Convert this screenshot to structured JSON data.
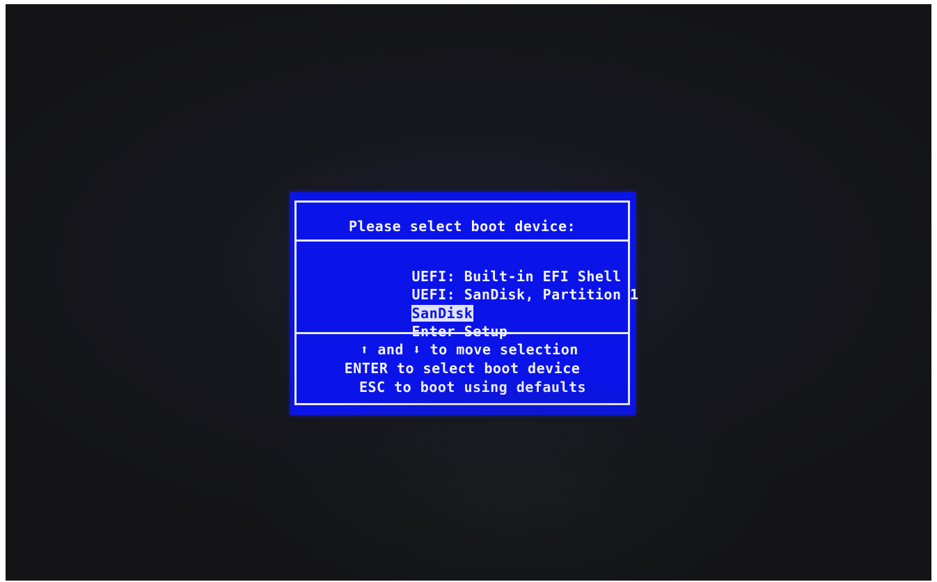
{
  "boot_menu": {
    "title": "Please select boot device:",
    "devices": [
      {
        "label": "UEFI: Built-in EFI Shell",
        "selected": false
      },
      {
        "label": "UEFI: SanDisk, Partition 1",
        "selected": false
      },
      {
        "label": "SanDisk",
        "selected": true
      },
      {
        "label": "Enter Setup",
        "selected": false
      }
    ],
    "help": {
      "up_arrow": "⬆",
      "and_text": "and",
      "down_arrow": "⬇",
      "move_text": "to move selection",
      "enter_line": "ENTER to select boot device",
      "esc_line": "ESC to boot using defaults"
    }
  },
  "colors": {
    "dialog_background": "#0a14e8",
    "text": "#f2f3ff",
    "selection_background": "#dfe2ff",
    "screen_background": "#151517"
  }
}
